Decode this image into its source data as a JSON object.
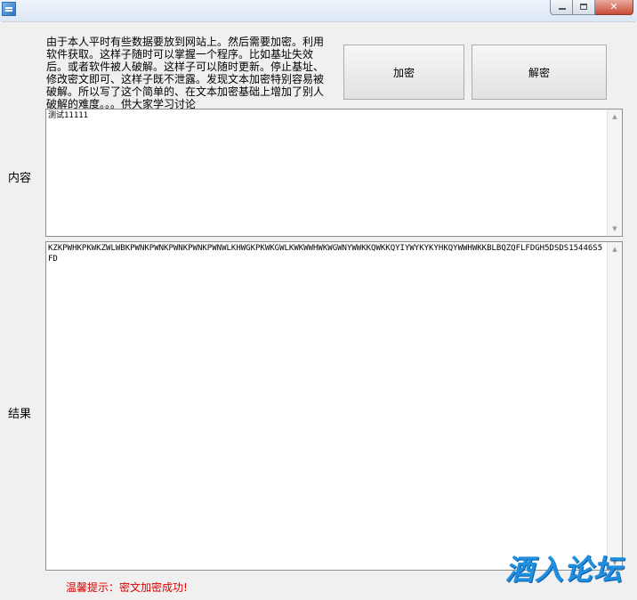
{
  "window": {
    "title": "",
    "controls": {
      "minimize": "minimize-icon",
      "maximize": "maximize-icon",
      "close": "close-icon"
    }
  },
  "description": "由于本人平时有些数据要放到网站上。然后需要加密。利用\n软件获取。这样子随时可以掌握一个程序。比如基址失效\n后。或者软件被人破解。这样子可以随时更新。停止基址、\n修改密文即可、这样子既不泄露。发现文本加密特别容易被\n破解。所以写了这个简单的、在文本加密基础上增加了别人\n破解的难度。。。供大家学习讨论",
  "buttons": {
    "encrypt": "加密",
    "decrypt": "解密"
  },
  "labels": {
    "content": "内容",
    "result": "结果"
  },
  "content_text": "测试11111",
  "result_text": "KZKPWHKPKWKZWLWBKPWNKPWNKPWNKPWNKPWNWLKHWGKPKWKGWLKWKWWHWKWGWNYWWKKQWKKQYIYWYKYKYHKQYWWHWKKBLBQZQFLFDGH5DSDS15446S5FD",
  "status_tip": "温馨提示：密文加密成功!",
  "watermark": "酒入论坛",
  "colors": {
    "tip": "#e00000",
    "watermark": "#1f8fe0"
  }
}
